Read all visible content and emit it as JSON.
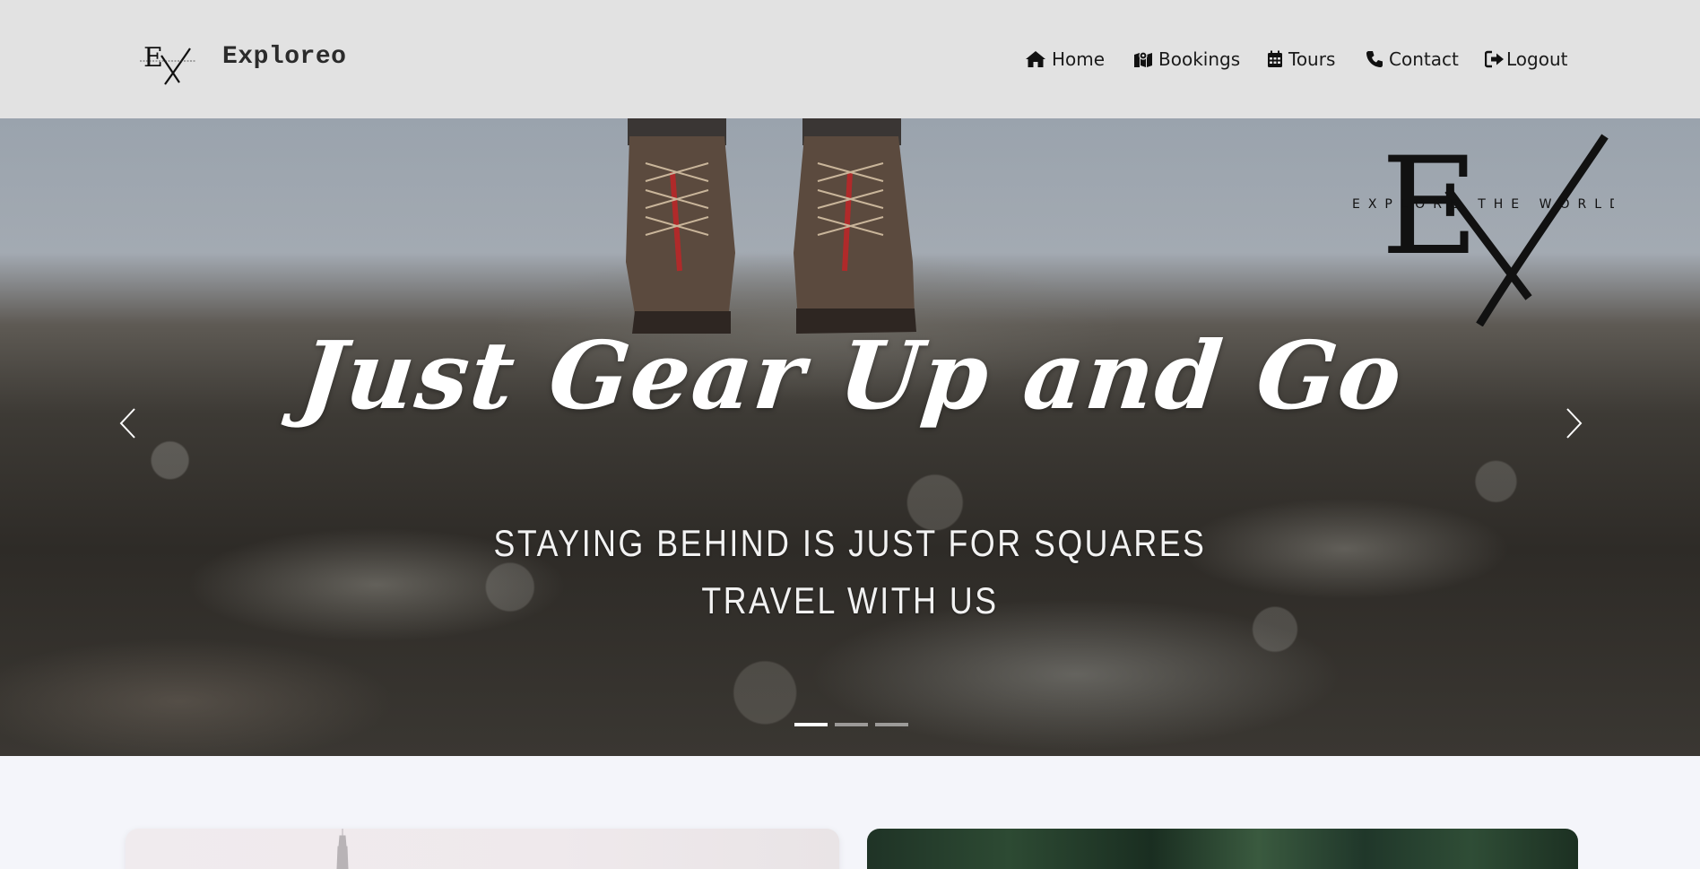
{
  "brand": {
    "name": "Exploreo",
    "logo_text": "EX"
  },
  "nav": {
    "items": [
      {
        "label": "Home",
        "icon": "home-icon"
      },
      {
        "label": "Bookings",
        "icon": "map-icon"
      },
      {
        "label": "Tours",
        "icon": "calendar-icon"
      },
      {
        "label": "Contact",
        "icon": "phone-icon"
      },
      {
        "label": "Logout",
        "icon": "logout-icon"
      }
    ]
  },
  "hero": {
    "logo_letters": "EX",
    "logo_tagline": "EXPLORE THE WORLD",
    "title": "Just Gear Up and Go",
    "subtitle_line1": "STAYING BEHIND IS JUST FOR SQUARES",
    "subtitle_line2": "TRAVEL WITH US",
    "slides_total": 3,
    "active_slide": 1
  },
  "colors": {
    "navbar_bg": "#e2e2e2",
    "page_bg": "#f4f5fa",
    "hero_text": "#ffffff"
  }
}
